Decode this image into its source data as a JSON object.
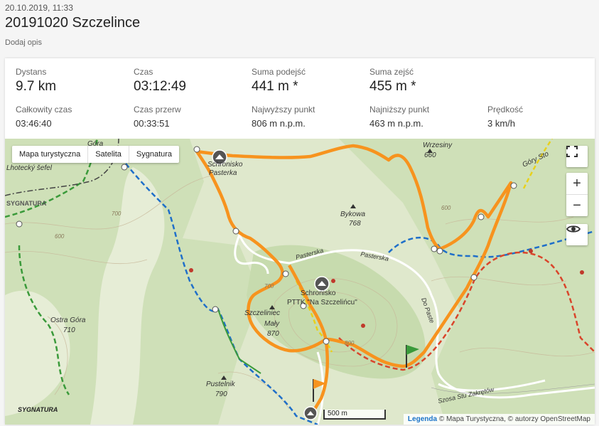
{
  "header": {
    "date": "20.10.2019, 11:33",
    "title": "20191020 Szczelince",
    "description_link": "Dodaj opis"
  },
  "stats": {
    "distance": {
      "label": "Dystans",
      "value": "9.7 km"
    },
    "time": {
      "label": "Czas",
      "value": "03:12:49"
    },
    "ascent": {
      "label": "Suma podejść",
      "value": "441 m *"
    },
    "descent": {
      "label": "Suma zejść",
      "value": "455 m *"
    },
    "total_time": {
      "label": "Całkowity czas",
      "value": "03:46:40"
    },
    "breaks": {
      "label": "Czas przerw",
      "value": "00:33:51"
    },
    "highest": {
      "label": "Najwyższy punkt",
      "value": "806 m n.p.m."
    },
    "lowest": {
      "label": "Najniższy punkt",
      "value": "463 m n.p.m."
    },
    "speed": {
      "label": "Prędkość",
      "value": "3 km/h"
    }
  },
  "map": {
    "layer_tabs": [
      "Mapa turystyczna",
      "Satelita",
      "Sygnatura"
    ],
    "zoom_in": "+",
    "zoom_out": "−",
    "scale": "500 m",
    "attribution_link": "Legenda",
    "attribution_text": "© Mapa Turystyczna, © autorzy OpenStreetMap",
    "logo": "SYGNATURA",
    "icons": [
      "fullscreen-icon",
      "eye-icon",
      "shelter-icon",
      "start-flag-icon",
      "finish-flag-icon"
    ],
    "labels": {
      "gora": "Góra",
      "lhotecky": "Lhotecký šefel",
      "sygnatura_wm": "SYGNATURA",
      "schronisko_pasterka_1": "Schronisko",
      "schronisko_pasterka_2": "Pasterka",
      "bykowa": "Bykowa",
      "bykowa_h": "768",
      "wrzesiny": "Wrzesiny",
      "wrzesiny_h": "660",
      "pasterska1": "Pasterska",
      "pasterska2": "Pasterska",
      "schronisko_szcz_1": "Schronisko",
      "schronisko_szcz_2": "PTTK \"Na Szczelińcu\"",
      "szczeliniec_1": "Szczeliniec",
      "szczeliniec_2": "Mały",
      "szczeliniec_h": "870",
      "ostra_1": "Ostra Góra",
      "ostra_h": "710",
      "pustelnik": "Pustelnik",
      "pustelnik_h": "790",
      "do_paste": "Do Paste",
      "szosa": "Szosa Stu Zakrętów",
      "gory": "Góry Sto",
      "c700": "700",
      "c600": "600",
      "c800": "800",
      "c600b": "600",
      "c700b": "700"
    },
    "colors": {
      "track": "#f7931e",
      "blue_trail": "#1f6fc9",
      "green_trail": "#3a9a3a",
      "red_trail": "#d9452b",
      "yellow_trail": "#e8d11b",
      "forest": "#cfe0b8"
    }
  }
}
